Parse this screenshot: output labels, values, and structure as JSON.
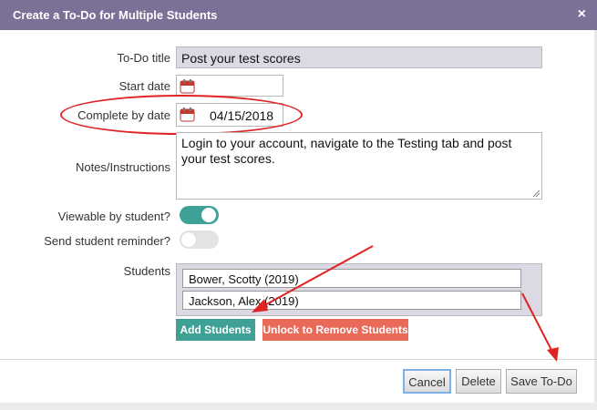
{
  "dialog": {
    "title": "Create a To-Do for Multiple Students",
    "close_glyph": "×"
  },
  "form": {
    "todo_title_label": "To-Do title",
    "todo_title_value": "Post your test scores",
    "start_date_label": "Start date",
    "start_date_value": "",
    "complete_by_label": "Complete by date",
    "complete_by_value": "04/15/2018",
    "notes_label": "Notes/Instructions",
    "notes_value": "Login to your account, navigate to the Testing tab  and post your test scores.",
    "viewable_label": "Viewable by student?",
    "viewable_on": true,
    "reminder_label": "Send student reminder?",
    "reminder_on": false,
    "students_label": "Students",
    "students": [
      "Bower, Scotty (2019)",
      "Jackson, Alex (2019)"
    ],
    "add_students_label": "Add Students",
    "unlock_label": "Unlock to Remove Students"
  },
  "footer": {
    "cancel_label": "Cancel",
    "delete_label": "Delete",
    "save_label": "Save To-Do"
  },
  "colors": {
    "titlebar": "#7b7196",
    "teal": "#3fa195",
    "salmon": "#ea6a5a",
    "annotation_red": "#e02323"
  },
  "icons": {
    "calendar": "calendar-icon",
    "close": "close-icon"
  }
}
